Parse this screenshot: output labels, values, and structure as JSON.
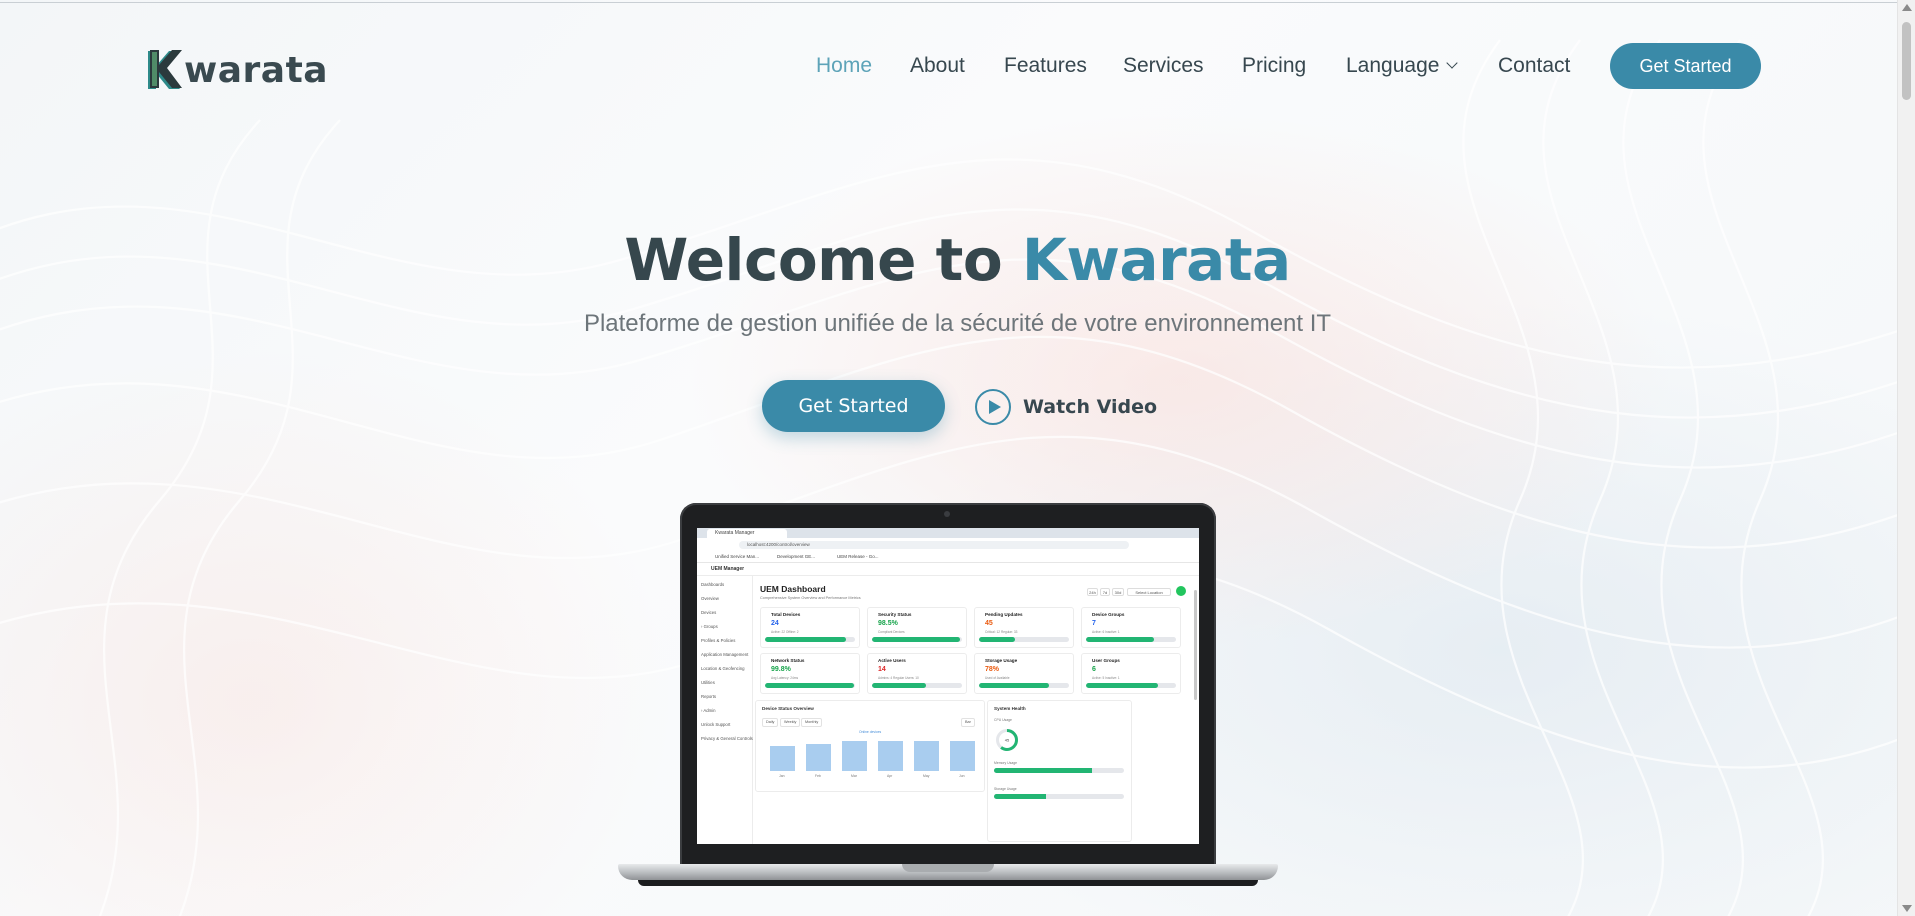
{
  "brand": {
    "logo_letter": "K",
    "logo_rest": "warata"
  },
  "nav": {
    "items": [
      {
        "label": "Home",
        "active": true
      },
      {
        "label": "About"
      },
      {
        "label": "Features"
      },
      {
        "label": "Services"
      },
      {
        "label": "Pricing"
      },
      {
        "label": "Language",
        "dropdown": true
      },
      {
        "label": "Contact"
      }
    ],
    "cta_label": "Get Started"
  },
  "hero": {
    "title_prefix": "Welcome to ",
    "title_accent": "Kwarata",
    "subtitle": "Plateforme de gestion unifiée de la sécurité de votre environnement IT",
    "primary_button": "Get Started",
    "video_button": "Watch Video"
  },
  "colors": {
    "accent": "#3a8aa8",
    "nav_active": "#5da3b8",
    "text_dark": "#36474d",
    "progress": "#22b573"
  },
  "icons": {
    "play": "play-icon",
    "chevron": "chevron-down-icon",
    "logo": "kwarata-logo"
  },
  "preview": {
    "browser_tab": "Kwarata Manager",
    "address": "localhost:4200/control/overview",
    "bookmarks": [
      "Unified Service Man...",
      "Development GE...",
      "UEM Release - Go..."
    ],
    "app_name": "UEM Manager",
    "sidebar": [
      "Dashboards",
      "Overview",
      "Devices",
      "› Groups",
      "Profiles & Policies",
      "Application Management",
      "Location & Geofencing",
      "Utilities",
      "Reports",
      "› Admin",
      "Unlock Support",
      "Privacy & General Controls"
    ],
    "title": "UEM Dashboard",
    "subtitle": "Comprehensive System Overview and Performance Metrics",
    "range": [
      "24h",
      "7d",
      "30d"
    ],
    "location_select": "Select Location",
    "cards": [
      {
        "title": "Total Devices",
        "value": "24",
        "sub": "Active: 22 Offline: 2",
        "color": "#2563eb",
        "pct": 90
      },
      {
        "title": "Security Status",
        "value": "98.5%",
        "sub": "Compliant Devices",
        "color": "#16a34a",
        "pct": 98
      },
      {
        "title": "Pending Updates",
        "value": "45",
        "sub": "Critical: 12 Regular: 33",
        "color": "#ea580c",
        "pct": 40
      },
      {
        "title": "Device Groups",
        "value": "7",
        "sub": "Active: 6 Inactive: 1",
        "color": "#2563eb",
        "pct": 75
      },
      {
        "title": "Network Status",
        "value": "99.8%",
        "sub": "Avg Latency: 24ms",
        "color": "#16a34a",
        "pct": 99
      },
      {
        "title": "Active Users",
        "value": "14",
        "sub": "Admins: 4 Regular Users: 10",
        "color": "#dc2626",
        "pct": 60
      },
      {
        "title": "Storage Usage",
        "value": "78%",
        "sub": "Used of Available",
        "color": "#ea580c",
        "pct": 78
      },
      {
        "title": "User Groups",
        "value": "6",
        "sub": "Active: 5 Inactive: 1",
        "color": "#16a34a",
        "pct": 80
      }
    ],
    "chart": {
      "title": "Device Status Overview",
      "tabs": [
        "Daily",
        "Weekly",
        "Monthly"
      ],
      "select": "Bar",
      "legend": "Online devices",
      "labels": [
        "Jan",
        "Feb",
        "Mar",
        "Apr",
        "May",
        "Jun"
      ],
      "values": [
        0.62,
        0.68,
        0.75,
        0.75,
        0.75,
        0.75
      ]
    },
    "health": {
      "title": "System Health",
      "cpu_label": "CPU Usage",
      "cpu_value": "45",
      "memory_label": "Memory Usage",
      "memory_pct": 75,
      "storage_label": "Storage Usage",
      "storage_pct": 40
    }
  }
}
